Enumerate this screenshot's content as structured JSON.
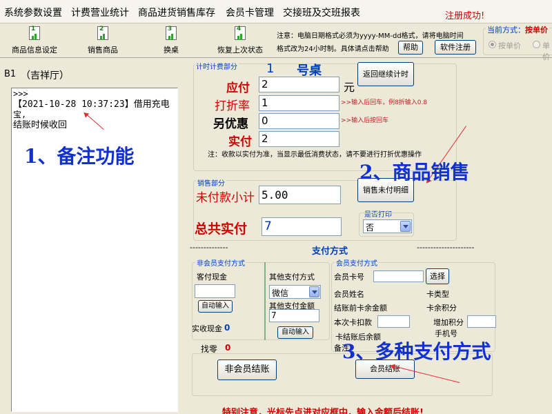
{
  "menu": {
    "items": [
      "系统参数设置",
      "计费营业统计",
      "商品进货销售库存",
      "会员卡管理",
      "交接班及交班报表"
    ],
    "status_message": "注册成功!"
  },
  "toolbar": {
    "buttons": [
      {
        "label": "商品信息设定",
        "num": "1"
      },
      {
        "label": "销售商品",
        "num": "2"
      },
      {
        "label": "换桌",
        "num": "3"
      },
      {
        "label": "恢复上次状态",
        "num": "4"
      }
    ],
    "notice_line1": "注意：电脑日期格式必须为yyyy-MM-dd格式，请将电脑时间",
    "notice_line2": "格式改为24小时制。具体请点击帮助",
    "help_button": "帮助",
    "register_button": "软件注册",
    "mode_label": "当前方式：",
    "mode_value": "按单价",
    "mode_options": [
      "按单价",
      "单价"
    ]
  },
  "left_panel": {
    "room_code": "B1",
    "room_name": "（吉祥厅）",
    "log_prompt": ">>>",
    "log_line1": "【2021-10-28 10:37:23】借用充电",
    "log_line2": "宝,",
    "log_line3": "结账时候收回"
  },
  "timing": {
    "section_title": "计时计费部分",
    "table_number": "1",
    "table_suffix": "号桌",
    "resume_button": "返回继续计时",
    "due_label": "应付",
    "due_value": "2",
    "due_unit": "元",
    "discount_label": "打折率",
    "discount_value": "1",
    "discount_hint": ">>输入后回车，例8折输入0.8",
    "extra_label": "另优惠",
    "extra_value": "0",
    "extra_hint": ">>输入后按回车",
    "paid_label": "实付",
    "paid_value": "2",
    "note": "注：收款以实付为准，当显示最低消费状态，请不要进行打折优惠操作"
  },
  "sales": {
    "section_title": "销售部分",
    "unpaid_label": "未付款小计",
    "unpaid_value": "5.00",
    "detail_button": "销售未付明细",
    "total_label": "总共实付",
    "total_value": "7",
    "print_label": "是否打印",
    "print_value": "否"
  },
  "payment": {
    "title": "支付方式",
    "dashes_left": "--------------",
    "dashes_right": "---------------------",
    "nonmember_title": "非会员支付方式",
    "cash_label": "客付现金",
    "cash_value": "",
    "auto_input_button": "自动输入",
    "actual_cash_label": "实收现金",
    "actual_cash_value": "0",
    "other_title": "其他支付方式",
    "other_method": "微信",
    "other_amount_label": "其他支付金额",
    "other_amount_value": "7",
    "other_auto_button": "自动输入",
    "change_label": "找零",
    "change_value": "0",
    "nonmember_checkout": "非会员结账",
    "member_title": "会员支付方式",
    "card_no_label": "会员卡号",
    "card_no_value": "",
    "choose_button": "选择",
    "member_name_label": "会员姓名",
    "card_type_label": "卡类型",
    "balance_before_label": "结账前卡余金额",
    "points_label": "卡余积分",
    "this_charge_label": "本次卡扣款",
    "this_charge_value": "",
    "add_points_label": "增加积分",
    "add_points_value": "",
    "phone_label": "手机号",
    "balance_after_label": "卡结账后余额",
    "remark_label": "备注",
    "member_checkout": "会员结账"
  },
  "bottom_note": "特别注意，光标先点进对应框中，输入金额后结账!",
  "annotations": {
    "a1": "1、备注功能",
    "a2": "2、商品销售",
    "a3": "3、多种支付方式"
  },
  "colors": {
    "accent_red": "#d00000",
    "label_blue": "#0040c0",
    "annotation_blue": "#1030d0"
  }
}
